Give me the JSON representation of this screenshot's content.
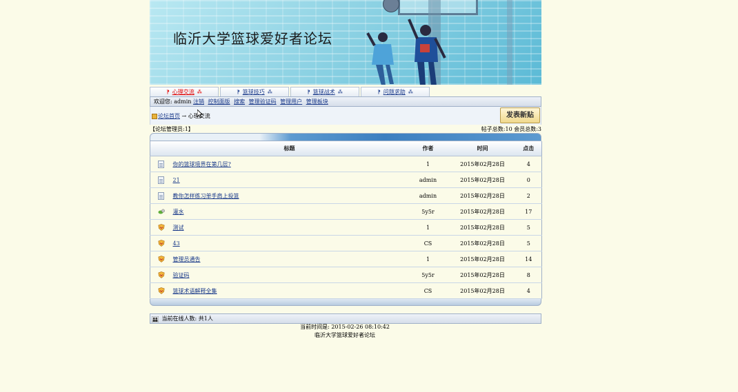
{
  "banner": {
    "title": "临沂大学篮球爱好者论坛"
  },
  "nav": {
    "tabs": [
      {
        "label": "心理交流",
        "active": true
      },
      {
        "label": "篮球技巧",
        "active": false
      },
      {
        "label": "篮球战术",
        "active": false
      },
      {
        "label": "问题求助",
        "active": false
      }
    ]
  },
  "welcome": {
    "prefix": "欢迎您:",
    "user": "admin",
    "links": [
      "注销",
      "控制面版",
      "搜索",
      "管理验证码",
      "管理用户",
      "管理板块"
    ]
  },
  "breadcrumb": {
    "home": "论坛首页",
    "arrow": "→",
    "current": "心理交流"
  },
  "post_button": "发表新贴",
  "meta": {
    "admins": "【论坛管理员:1】",
    "stats": "帖子总数:10 会员总数:3"
  },
  "table": {
    "headers": {
      "title": "标题",
      "author": "作者",
      "time": "时间",
      "clicks": "点击"
    },
    "rows": [
      {
        "icon": "doc",
        "title": "你的篮球境界在第几层?",
        "author": "1",
        "time": "2015年02月28日",
        "clicks": "4"
      },
      {
        "icon": "doc",
        "title": "21",
        "author": "admin",
        "time": "2015年02月28日",
        "clicks": "0"
      },
      {
        "icon": "doc",
        "title": "教你怎样练习单手肩上投篮",
        "author": "admin",
        "time": "2015年02月28日",
        "clicks": "2"
      },
      {
        "icon": "water",
        "title": "灌水",
        "author": "5y5r",
        "time": "2015年02月28日",
        "clicks": "17"
      },
      {
        "icon": "shield",
        "title": "测试",
        "author": "1",
        "time": "2015年02月28日",
        "clicks": "5"
      },
      {
        "icon": "shield",
        "title": "43",
        "author": "CS",
        "time": "2015年02月28日",
        "clicks": "5"
      },
      {
        "icon": "shield",
        "title": "管理员通告",
        "author": "1",
        "time": "2015年02月28日",
        "clicks": "14"
      },
      {
        "icon": "shield",
        "title": "验证码",
        "author": "5y5r",
        "time": "2015年02月28日",
        "clicks": "8"
      },
      {
        "icon": "shield",
        "title": "篮球术语解释全集",
        "author": "CS",
        "time": "2015年02月28日",
        "clicks": "4"
      }
    ]
  },
  "online": {
    "text": "当前在线人数: 共1人"
  },
  "footer": {
    "time": "当前时间是: 2015-02-26 08:10:42",
    "name": "临沂大学篮球爱好者论坛"
  },
  "colors": {
    "accent": "#1a3a8a",
    "active_tab": "#e00000",
    "page_bg": "#fbfbe8"
  }
}
